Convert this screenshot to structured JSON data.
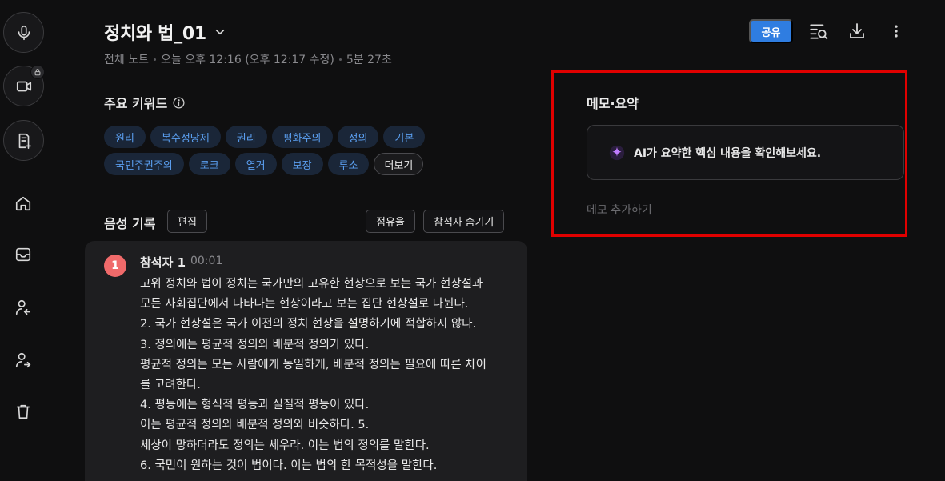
{
  "header": {
    "title": "정치와 법_01",
    "meta": {
      "location": "전체 노트",
      "time": "오늘 오후 12:16 (오후 12:17 수정)",
      "duration": "5분 27초"
    },
    "share_label": "공유"
  },
  "keywords": {
    "title": "주요 키워드",
    "items": [
      "원리",
      "복수정당제",
      "권리",
      "평화주의",
      "정의",
      "기본",
      "국민주권주의",
      "로크",
      "열거",
      "보장",
      "루소"
    ],
    "more_label": "더보기"
  },
  "voice": {
    "title": "음성 기록",
    "edit_label": "편집",
    "share_ratio_label": "점유율",
    "hide_participants_label": "참석자 숨기기",
    "speaker": {
      "number": "1",
      "name": "참석자 1",
      "time": "00:01"
    },
    "lines": [
      "고위 정치와 법이 정치는 국가만의 고유한 현상으로 보는 국가 현상설과",
      "모든 사회집단에서 나타나는 현상이라고 보는 집단 현상설로 나뉜다.",
      "2. 국가 현상설은 국가 이전의 정치 현상을 설명하기에 적합하지 않다.",
      "3. 정의에는 평균적 정의와 배분적 정의가 있다.",
      "평균적 정의는 모든 사람에게 동일하게, 배분적 정의는 필요에 따른 차이",
      "를 고려한다.",
      "4. 평등에는 형식적 평등과 실질적 평등이 있다.",
      "이는 평균적 정의와 배분적 정의와 비슷하다. 5.",
      "세상이 망하더라도 정의는 세우라. 이는 법의 정의를 말한다.",
      "6. 국민이 원하는 것이 법이다. 이는 법의 한 목적성을 말한다."
    ]
  },
  "memo": {
    "title": "메모·요약",
    "ai_prompt": "AI가 요약한 핵심 내용을 확인해보세요.",
    "add_label": "메모 추가하기"
  },
  "colors": {
    "accent": "#2f7de1",
    "chip_bg": "#1a2638",
    "chip_text": "#5b9ff0",
    "speaker_badge": "#f06a6a",
    "highlight_frame": "#e00000"
  }
}
